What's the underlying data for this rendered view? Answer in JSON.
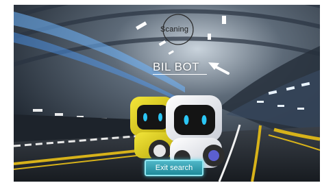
{
  "status": {
    "scanning_label": "Scaning"
  },
  "device": {
    "name": "BIL BOT"
  },
  "actions": {
    "exit_label": "Exit search"
  },
  "icons": {
    "scan": "scanning-ring-icon",
    "pointer": "arrow-pointer-icon"
  },
  "colors": {
    "exit_button": "#1f8a9a",
    "robot_yellow": "#e8d81a",
    "robot_white": "#eef0f4",
    "eyes": "#2bc6f5",
    "tunnel_light": "#6fb7ff"
  }
}
